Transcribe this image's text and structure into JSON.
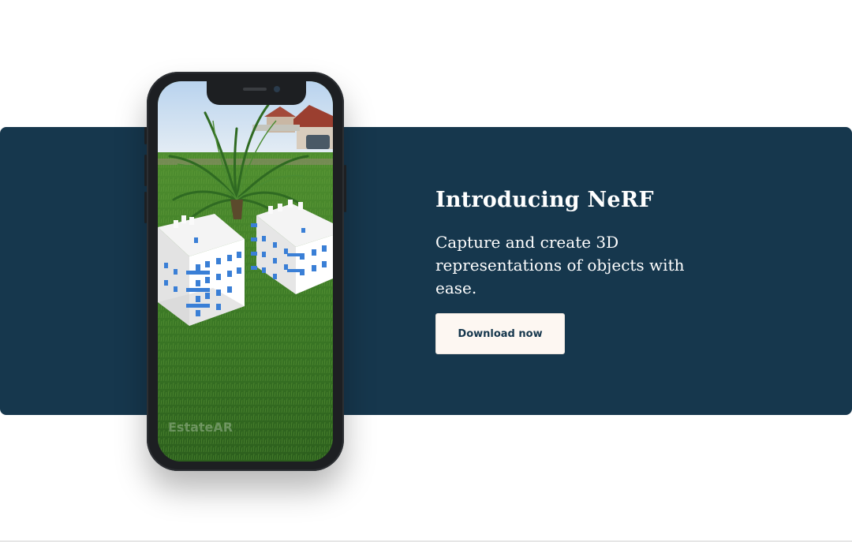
{
  "hero": {
    "title": "Introducing NeRF",
    "description": "Capture and create 3D representations of objects with ease.",
    "cta_label": "Download now"
  },
  "phone": {
    "watermark": "EstateAR"
  },
  "colors": {
    "banner": "#16374d",
    "button_bg": "#fdf7f2",
    "button_text": "#16374d",
    "grass": "#3f7a2a",
    "building_accent": "#3a7fd6"
  }
}
